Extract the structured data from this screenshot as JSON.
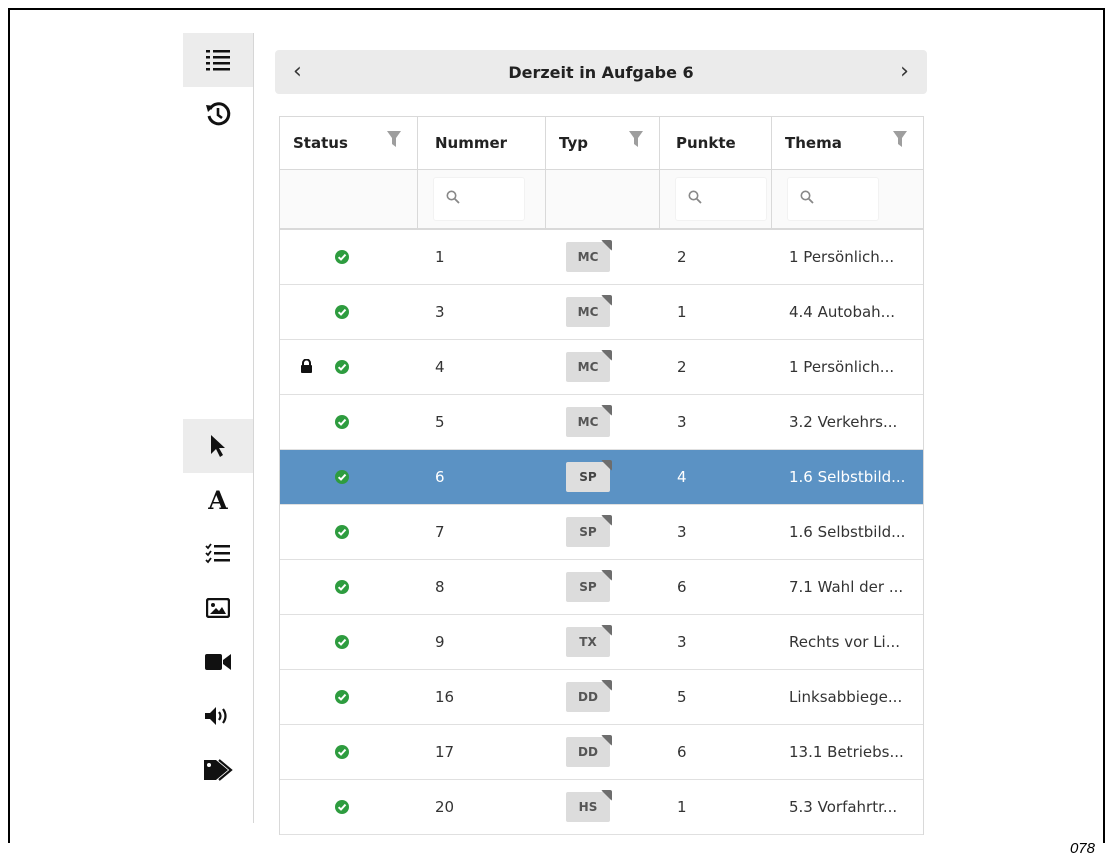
{
  "page_number": "078",
  "toolbar": {
    "top": [
      {
        "name": "task-list-icon",
        "active": true
      },
      {
        "name": "history-icon",
        "active": false
      }
    ],
    "bottom": [
      {
        "name": "pointer-icon",
        "active": true
      },
      {
        "name": "text-icon",
        "active": false
      },
      {
        "name": "checklist-icon",
        "active": false
      },
      {
        "name": "image-icon",
        "active": false
      },
      {
        "name": "video-icon",
        "active": false
      },
      {
        "name": "audio-icon",
        "active": false
      },
      {
        "name": "tags-icon",
        "active": false
      }
    ]
  },
  "navigation": {
    "title": "Derzeit in Aufgabe 6",
    "prev_symbol": "‹",
    "next_symbol": "›"
  },
  "table": {
    "columns": [
      {
        "label": "Status",
        "filter": true,
        "search": false
      },
      {
        "label": "Nummer",
        "filter": false,
        "search": true
      },
      {
        "label": "Typ",
        "filter": true,
        "search": false
      },
      {
        "label": "Punkte",
        "filter": false,
        "search": true
      },
      {
        "label": "Thema",
        "filter": true,
        "search": true
      }
    ],
    "rows": [
      {
        "locked": false,
        "done": true,
        "nummer": "1",
        "typ": "MC",
        "punkte": "2",
        "thema": "1 Persönlich...",
        "selected": false
      },
      {
        "locked": false,
        "done": true,
        "nummer": "3",
        "typ": "MC",
        "punkte": "1",
        "thema": "4.4 Autobah...",
        "selected": false
      },
      {
        "locked": true,
        "done": true,
        "nummer": "4",
        "typ": "MC",
        "punkte": "2",
        "thema": "1 Persönlich...",
        "selected": false
      },
      {
        "locked": false,
        "done": true,
        "nummer": "5",
        "typ": "MC",
        "punkte": "3",
        "thema": "3.2 Verkehrs...",
        "selected": false
      },
      {
        "locked": false,
        "done": true,
        "nummer": "6",
        "typ": "SP",
        "punkte": "4",
        "thema": "1.6 Selbstbild...",
        "selected": true
      },
      {
        "locked": false,
        "done": true,
        "nummer": "7",
        "typ": "SP",
        "punkte": "3",
        "thema": "1.6 Selbstbild...",
        "selected": false
      },
      {
        "locked": false,
        "done": true,
        "nummer": "8",
        "typ": "SP",
        "punkte": "6",
        "thema": "7.1 Wahl der ...",
        "selected": false
      },
      {
        "locked": false,
        "done": true,
        "nummer": "9",
        "typ": "TX",
        "punkte": "3",
        "thema": "Rechts vor Li...",
        "selected": false
      },
      {
        "locked": false,
        "done": true,
        "nummer": "16",
        "typ": "DD",
        "punkte": "5",
        "thema": "Linksabbiege...",
        "selected": false
      },
      {
        "locked": false,
        "done": true,
        "nummer": "17",
        "typ": "DD",
        "punkte": "6",
        "thema": "13.1 Betriebs...",
        "selected": false
      },
      {
        "locked": false,
        "done": true,
        "nummer": "20",
        "typ": "HS",
        "punkte": "1",
        "thema": "5.3 Vorfahrtr...",
        "selected": false
      }
    ]
  },
  "colors": {
    "check": "#2e9c3f",
    "selected_row": "#5b92c4",
    "funnel": "#9e9e9e"
  }
}
